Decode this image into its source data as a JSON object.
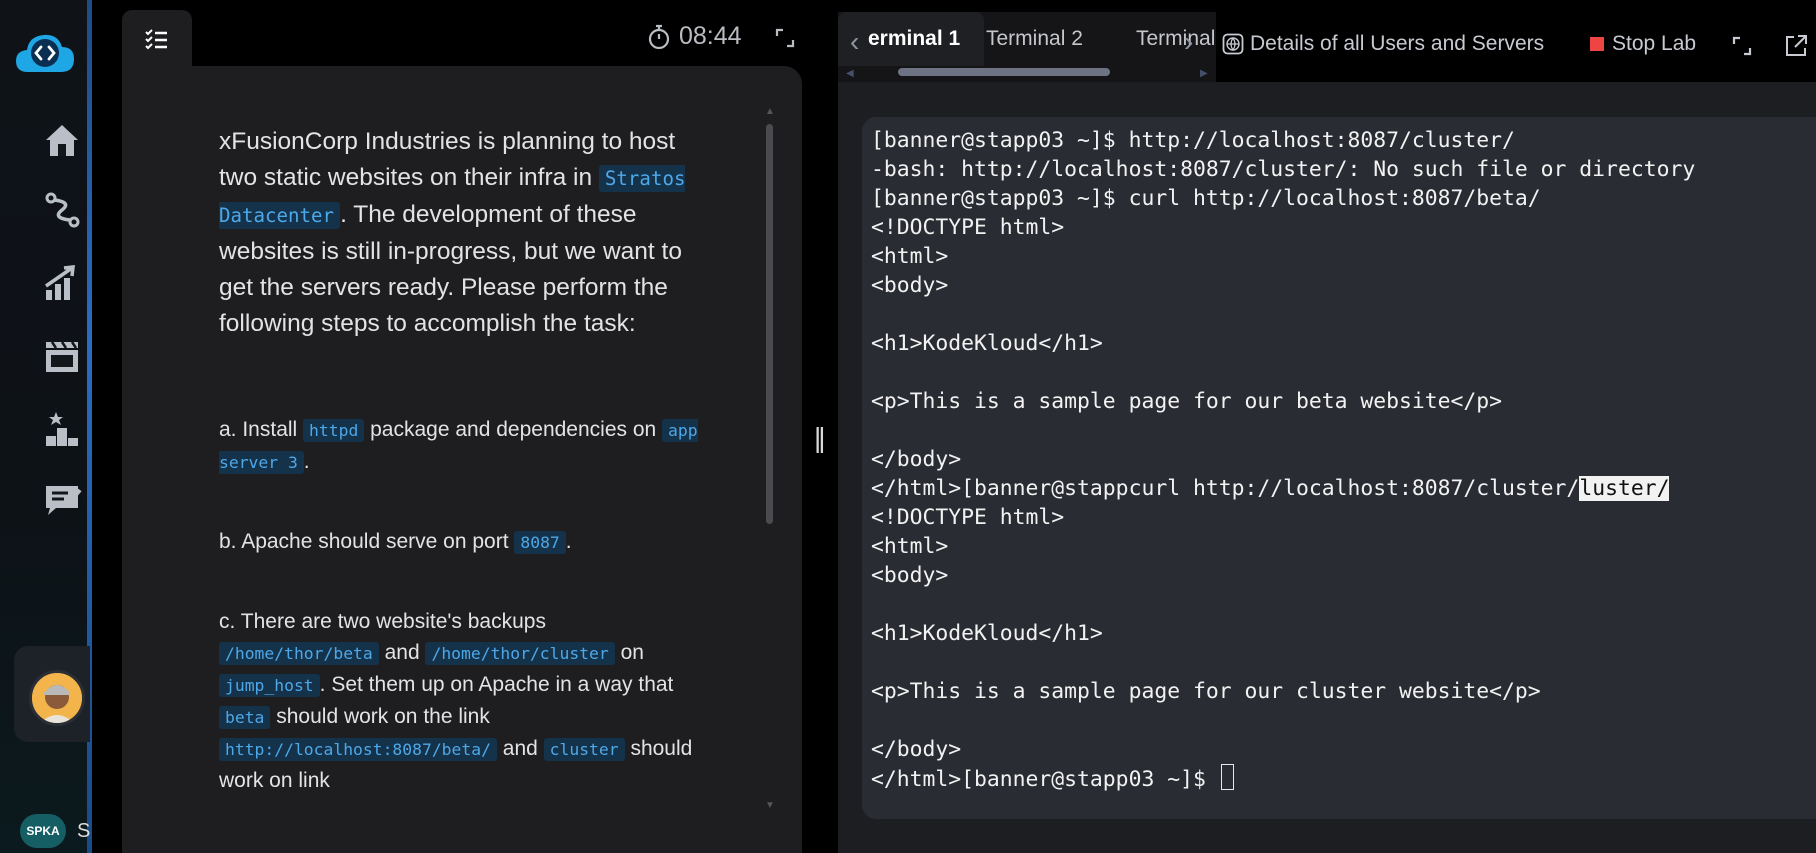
{
  "task": {
    "timer": "08:44",
    "intro": [
      {
        "text": "xFusionCorp Industries is planning to host two static websites on their infra in "
      },
      {
        "code": "Stratos Datacenter"
      },
      {
        "text": ". The development of these websites is still in-progress, but we want to get the servers ready. Please perform the following steps to accomplish the task:"
      }
    ],
    "steps": [
      [
        {
          "text": "a. Install "
        },
        {
          "code": "httpd"
        },
        {
          "text": " package and dependencies on "
        },
        {
          "code": "app server 3"
        },
        {
          "text": "."
        }
      ],
      [
        {
          "text": "b. Apache should serve on port "
        },
        {
          "code": "8087"
        },
        {
          "text": "."
        }
      ],
      [
        {
          "text": "c. There are two website's backups "
        },
        {
          "code": "/home/thor/beta"
        },
        {
          "text": " and "
        },
        {
          "code": "/home/thor/cluster"
        },
        {
          "text": " on "
        },
        {
          "code": "jump_host"
        },
        {
          "text": ". Set them up on Apache in a way that "
        },
        {
          "code": "beta"
        },
        {
          "text": " should work on the link "
        },
        {
          "code": "http://localhost:8087/beta/"
        },
        {
          "text": " and "
        },
        {
          "code": "cluster"
        },
        {
          "text": " should work on link"
        }
      ]
    ]
  },
  "terminal_tabs": [
    "erminal 1",
    "Terminal 2",
    "Terminal"
  ],
  "header": {
    "details_link": "Details of all Users and Servers",
    "stop_lab": "Stop Lab"
  },
  "user": {
    "initials": "SPKA",
    "name_initial": "S"
  },
  "terminal_lines": [
    "[banner@stapp03 ~]$ http://localhost:8087/cluster/",
    "-bash: http://localhost:8087/cluster/: No such file or directory",
    "[banner@stapp03 ~]$ curl http://localhost:8087/beta/",
    "<!DOCTYPE html>",
    "<html>",
    "<body>",
    "",
    "<h1>KodeKloud</h1>",
    "",
    "<p>This is a sample page for our beta website</p>",
    "",
    "</body>",
    "</html>[banner@stappcurl http://localhost:8087/cluster/luster/",
    "<!DOCTYPE html>",
    "<html>",
    "<body>",
    "",
    "<h1>KodeKloud</h1>",
    "",
    "<p>This is a sample page for our cluster website</p>",
    "",
    "</body>",
    "</html>[banner@stapp03 ~]$ "
  ],
  "terminal_selection": "luster/",
  "colors": {
    "accent": "#4ea8e8",
    "stop": "#ef4444",
    "sidebar_edge": "#2a6cc0"
  },
  "icons": [
    "logo-icon",
    "home-icon",
    "path-icon",
    "progress-icon",
    "courses-icon",
    "leaderboard-icon",
    "feedback-icon",
    "task-list-icon",
    "timer-icon",
    "expand-icon",
    "globe-icon",
    "popout-icon"
  ]
}
